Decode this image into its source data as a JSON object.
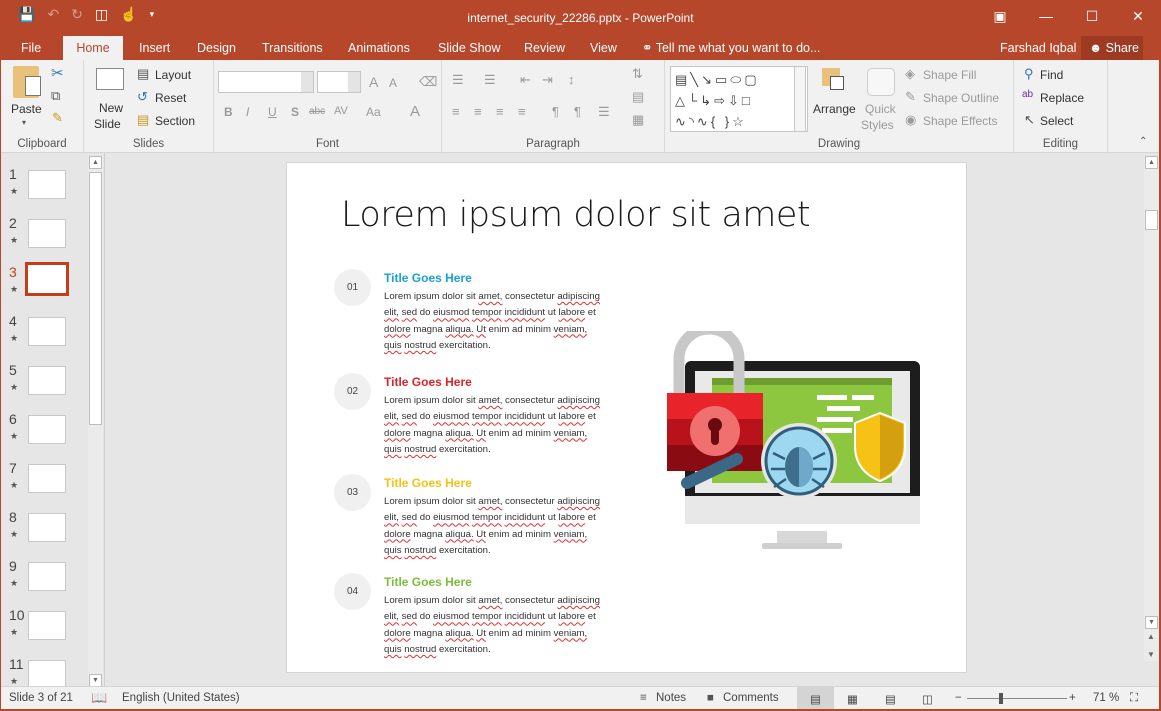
{
  "window": {
    "title": "internet_security_22286.pptx - PowerPoint",
    "controls": [
      "ribbon-display-options",
      "minimize",
      "maximize",
      "close"
    ]
  },
  "quick_access": [
    "save",
    "undo",
    "redo",
    "present-from-beginning",
    "touch-mode",
    "customize"
  ],
  "tabs": [
    {
      "label": "File"
    },
    {
      "label": "Home",
      "active": true
    },
    {
      "label": "Insert"
    },
    {
      "label": "Design"
    },
    {
      "label": "Transitions"
    },
    {
      "label": "Animations"
    },
    {
      "label": "Slide Show"
    },
    {
      "label": "Review"
    },
    {
      "label": "View"
    }
  ],
  "tell_me": "Tell me what you want to do...",
  "user": "Farshad Iqbal",
  "share_label": "Share",
  "ribbon": {
    "clipboard": {
      "label": "Clipboard",
      "paste": "Paste"
    },
    "slides": {
      "label": "Slides",
      "new_slide_1": "New",
      "new_slide_2": "Slide",
      "layout": "Layout",
      "reset": "Reset",
      "section": "Section"
    },
    "font": {
      "label": "Font",
      "font_name": "",
      "font_size": "",
      "bold": "B",
      "italic": "I",
      "underline": "U",
      "shadow": "S",
      "strike": "abc",
      "spacing": "AV",
      "case": "Aa",
      "color": "A",
      "grow": "A",
      "shrink": "A"
    },
    "paragraph": {
      "label": "Paragraph"
    },
    "drawing": {
      "label": "Drawing",
      "arrange": "Arrange",
      "quick_1": "Quick",
      "quick_2": "Styles",
      "shape_fill": "Shape Fill",
      "shape_outline": "Shape Outline",
      "shape_effects": "Shape Effects"
    },
    "editing": {
      "label": "Editing",
      "find": "Find",
      "replace": "Replace",
      "select": "Select"
    }
  },
  "thumbnails": [
    {
      "num": "1"
    },
    {
      "num": "2"
    },
    {
      "num": "3",
      "current": true
    },
    {
      "num": "4"
    },
    {
      "num": "5"
    },
    {
      "num": "6"
    },
    {
      "num": "7"
    },
    {
      "num": "8"
    },
    {
      "num": "9"
    },
    {
      "num": "10"
    },
    {
      "num": "11"
    }
  ],
  "slide": {
    "title": "Lorem ipsum dolor sit amet",
    "items": [
      {
        "num": "01",
        "title": "Title Goes Here",
        "color": "#1aa0d8"
      },
      {
        "num": "02",
        "title": "Title Goes Here",
        "color": "#d9232a"
      },
      {
        "num": "03",
        "title": "Title Goes Here",
        "color": "#f5c215"
      },
      {
        "num": "04",
        "title": "Title Goes Here",
        "color": "#7cbd3a"
      }
    ],
    "body_lines": [
      "Lorem ipsum dolor sit amet, consectetur adipiscing",
      "elit, sed do eiusmod tempor incididunt ut labore et",
      "dolore magna aliqua. Ut enim ad minim veniam,",
      "quis nostrud exercitation."
    ]
  },
  "status": {
    "slide_info": "Slide 3 of 21",
    "language": "English (United States)",
    "notes": "Notes",
    "comments": "Comments",
    "zoom": "71 %",
    "zoom_value_percent": 71
  }
}
